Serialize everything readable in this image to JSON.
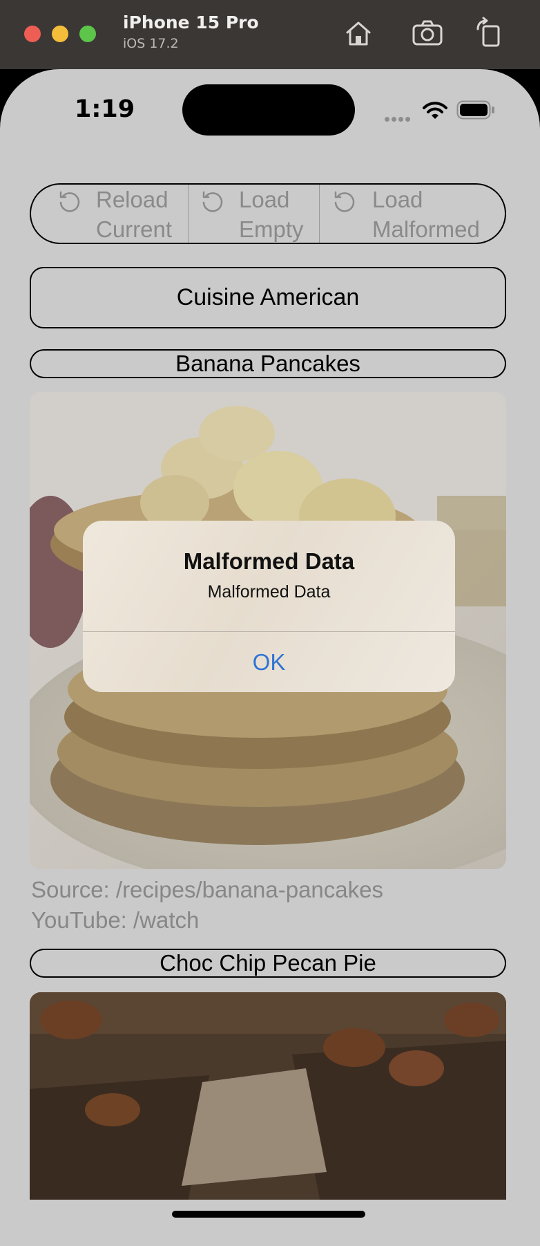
{
  "simulator": {
    "device_name": "iPhone 15 Pro",
    "os_version": "iOS 17.2"
  },
  "status_bar": {
    "time": "1:19"
  },
  "segmented_control": {
    "items": [
      {
        "label": "Reload\nCurrent",
        "icon": "reload-icon"
      },
      {
        "label": "Load\nEmpty",
        "icon": "reload-icon"
      },
      {
        "label": "Load\nMalformed",
        "icon": "reload-icon"
      }
    ]
  },
  "cuisine_button": {
    "label": "Cuisine American"
  },
  "recipes": [
    {
      "name": "Banana Pancakes",
      "source": "Source: /recipes/banana-pancakes",
      "youtube": "YouTube: /watch"
    },
    {
      "name": "Choc Chip Pecan Pie"
    }
  ],
  "alert": {
    "title": "Malformed Data",
    "message": "Malformed Data",
    "ok_label": "OK"
  },
  "colors": {
    "accent_blue": "#2f74d6",
    "dim_overlay_bg": "#cacaca",
    "close": "#ee5e55",
    "minimize": "#f4be3a",
    "maximize": "#5dc54a"
  }
}
